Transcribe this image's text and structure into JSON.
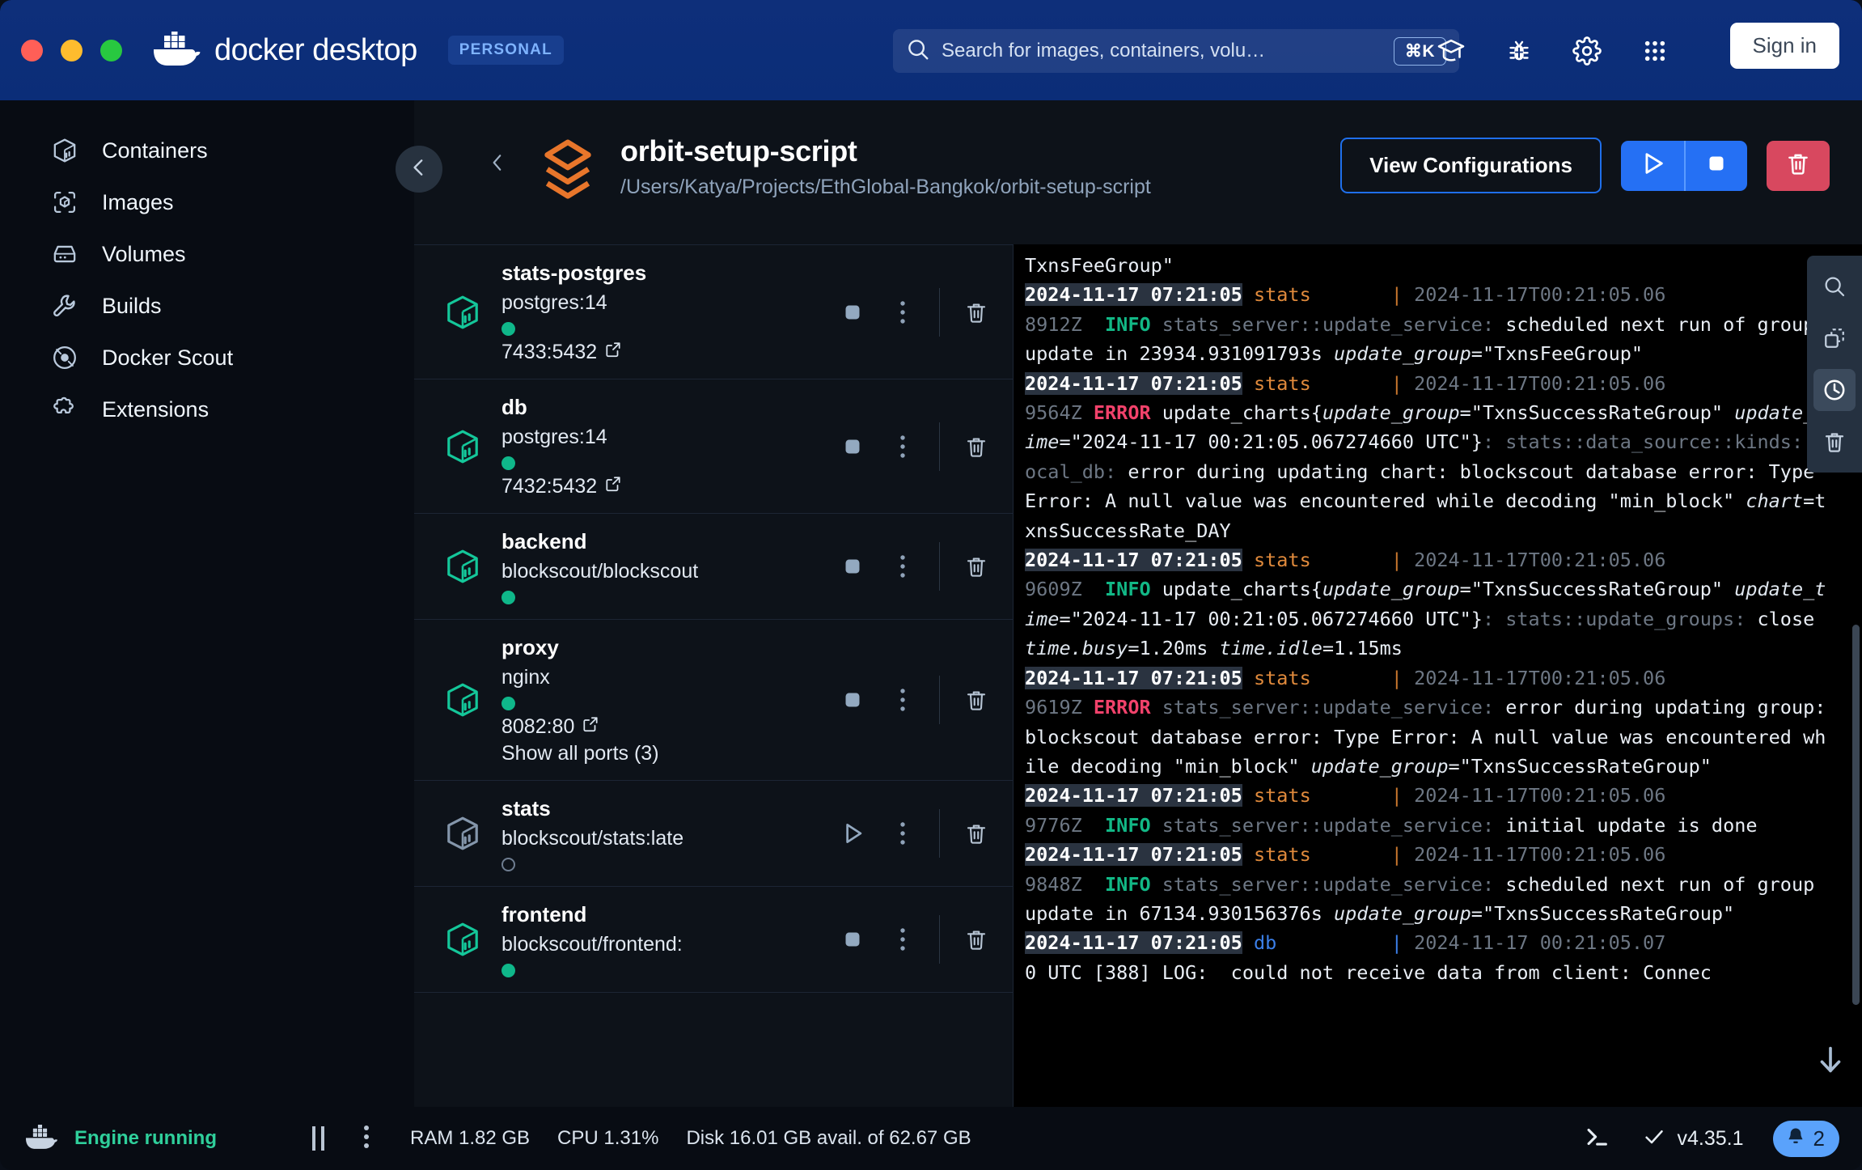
{
  "titlebar": {
    "brand": "docker desktop",
    "badge": "PERSONAL",
    "search_placeholder": "Search for images, containers, volu…",
    "search_value": "",
    "shortcut": "⌘K",
    "icons": [
      "learning-center-icon",
      "bug-icon",
      "gear-icon",
      "apps-grid-icon"
    ],
    "signin_label": "Sign in"
  },
  "sidebar": {
    "items": [
      {
        "label": "Containers",
        "icon": "container-cube-icon"
      },
      {
        "label": "Images",
        "icon": "images-icon"
      },
      {
        "label": "Volumes",
        "icon": "volumes-icon"
      },
      {
        "label": "Builds",
        "icon": "wrench-icon"
      },
      {
        "label": "Docker Scout",
        "icon": "scout-icon"
      },
      {
        "label": "Extensions",
        "icon": "puzzle-icon"
      }
    ]
  },
  "page": {
    "title": "orbit-setup-script",
    "path": "/Users/Katya/Projects/EthGlobal-Bangkok/orbit-setup-script",
    "view_configurations_label": "View Configurations",
    "actions": [
      "start-button",
      "stop-button",
      "delete-button"
    ]
  },
  "containers": [
    {
      "name": "stats-postgres",
      "image": "postgres:14",
      "state": "running",
      "port": "7433:5432",
      "more_ports": "",
      "action": "stop"
    },
    {
      "name": "db",
      "image": "postgres:14",
      "state": "running",
      "port": "7432:5432",
      "more_ports": "",
      "action": "stop"
    },
    {
      "name": "backend",
      "image": "blockscout/blockscout",
      "state": "running",
      "port": "",
      "more_ports": "",
      "action": "stop"
    },
    {
      "name": "proxy",
      "image": "nginx",
      "state": "running",
      "port": "8082:80",
      "more_ports": "Show all ports (3)",
      "action": "stop"
    },
    {
      "name": "stats",
      "image": "blockscout/stats:late",
      "state": "exited",
      "port": "",
      "more_ports": "",
      "action": "start"
    },
    {
      "name": "frontend",
      "image": "blockscout/frontend:",
      "state": "running",
      "port": "",
      "more_ports": "",
      "action": "stop"
    }
  ],
  "logs": {
    "tools": [
      "search-icon",
      "copy-icon",
      "clock-icon",
      "trash-icon"
    ],
    "active_tool": "clock-icon",
    "lines": [
      {
        "type": "cont",
        "segments": [
          {
            "t": "TxnsFeeGroup\"",
            "c": "wh"
          }
        ]
      },
      {
        "type": "head",
        "ts": "2024-11-17 07:21:05",
        "svc": "stats",
        "svc_color": "svc-stats",
        "tail": "2024-11-17T00:21:05.06"
      },
      {
        "type": "cont",
        "segments": [
          {
            "t": "8912Z ",
            "c": "dim"
          },
          {
            "t": " INFO",
            "c": "lv-info"
          },
          {
            "t": " stats_server::update_service: ",
            "c": "dim"
          },
          {
            "t": "scheduled next run of group update in 23934.931091793s ",
            "c": "wh"
          },
          {
            "t": "update_group",
            "c": "em"
          },
          {
            "t": "=\"TxnsFeeGroup\"",
            "c": "wh"
          }
        ]
      },
      {
        "type": "head",
        "ts": "2024-11-17 07:21:05",
        "svc": "stats",
        "svc_color": "svc-stats",
        "tail": "2024-11-17T00:21:05.06"
      },
      {
        "type": "cont",
        "segments": [
          {
            "t": "9564Z ",
            "c": "dim"
          },
          {
            "t": "ERROR",
            "c": "lv-error"
          },
          {
            "t": " update_charts{",
            "c": "wh"
          },
          {
            "t": "update_group",
            "c": "em"
          },
          {
            "t": "=\"TxnsSuccessRateGroup\" ",
            "c": "wh"
          },
          {
            "t": "update_time",
            "c": "em"
          },
          {
            "t": "=\"2024-11-17 00:21:05.067274660 UTC\"}",
            "c": "wh"
          },
          {
            "t": ": stats::data_source::kinds::local_db: ",
            "c": "dim"
          },
          {
            "t": "error during updating chart: blockscout database error: Type Error: A null value was encountered while decoding \"min_block\" ",
            "c": "wh"
          },
          {
            "t": "chart",
            "c": "em"
          },
          {
            "t": "=txnsSuccessRate_DAY",
            "c": "wh"
          }
        ]
      },
      {
        "type": "head",
        "ts": "2024-11-17 07:21:05",
        "svc": "stats",
        "svc_color": "svc-stats",
        "tail": "2024-11-17T00:21:05.06"
      },
      {
        "type": "cont",
        "segments": [
          {
            "t": "9609Z ",
            "c": "dim"
          },
          {
            "t": " INFO",
            "c": "lv-info"
          },
          {
            "t": " update_charts{",
            "c": "wh"
          },
          {
            "t": "update_group",
            "c": "em"
          },
          {
            "t": "=\"TxnsSuccessRateGroup\" ",
            "c": "wh"
          },
          {
            "t": "update_time",
            "c": "em"
          },
          {
            "t": "=\"2024-11-17 00:21:05.067274660 UTC\"}",
            "c": "wh"
          },
          {
            "t": ": stats::update_groups: ",
            "c": "dim"
          },
          {
            "t": "close ",
            "c": "wh"
          },
          {
            "t": "time.busy",
            "c": "em"
          },
          {
            "t": "=1.20ms ",
            "c": "wh"
          },
          {
            "t": "time.idle",
            "c": "em"
          },
          {
            "t": "=1.15ms",
            "c": "wh"
          }
        ]
      },
      {
        "type": "head",
        "ts": "2024-11-17 07:21:05",
        "svc": "stats",
        "svc_color": "svc-stats",
        "tail": "2024-11-17T00:21:05.06"
      },
      {
        "type": "cont",
        "segments": [
          {
            "t": "9619Z ",
            "c": "dim"
          },
          {
            "t": "ERROR",
            "c": "lv-error"
          },
          {
            "t": " stats_server::update_service: ",
            "c": "dim"
          },
          {
            "t": "error during updating group: blockscout database error: Type Error: A null value was encountered while decoding \"min_block\" ",
            "c": "wh"
          },
          {
            "t": "update_group",
            "c": "em"
          },
          {
            "t": "=\"TxnsSuccessRateGroup\"",
            "c": "wh"
          }
        ]
      },
      {
        "type": "head",
        "ts": "2024-11-17 07:21:05",
        "svc": "stats",
        "svc_color": "svc-stats",
        "tail": "2024-11-17T00:21:05.06"
      },
      {
        "type": "cont",
        "segments": [
          {
            "t": "9776Z ",
            "c": "dim"
          },
          {
            "t": " INFO",
            "c": "lv-info"
          },
          {
            "t": " stats_server::update_service: ",
            "c": "dim"
          },
          {
            "t": "initial update is done",
            "c": "wh"
          }
        ]
      },
      {
        "type": "head",
        "ts": "2024-11-17 07:21:05",
        "svc": "stats",
        "svc_color": "svc-stats",
        "tail": "2024-11-17T00:21:05.06"
      },
      {
        "type": "cont",
        "segments": [
          {
            "t": "9848Z ",
            "c": "dim"
          },
          {
            "t": " INFO",
            "c": "lv-info"
          },
          {
            "t": " stats_server::update_service: ",
            "c": "dim"
          },
          {
            "t": "scheduled next run of group update in 67134.930156376s ",
            "c": "wh"
          },
          {
            "t": "update_group",
            "c": "em"
          },
          {
            "t": "=\"TxnsSuccessRateGroup\"",
            "c": "wh"
          }
        ]
      },
      {
        "type": "head",
        "ts": "2024-11-17 07:21:05",
        "svc": "db",
        "svc_color": "svc-db",
        "tail": "2024-11-17 00:21:05.07"
      },
      {
        "type": "cont",
        "segments": [
          {
            "t": "0 UTC [388] LOG:  could not receive data from client: Connec",
            "c": "wh"
          }
        ]
      }
    ]
  },
  "statusbar": {
    "engine": "Engine running",
    "ram": "RAM 1.82 GB",
    "cpu": "CPU 1.31%",
    "disk": "Disk 16.01 GB avail. of 62.67 GB",
    "version": "v4.35.1",
    "notifications": "2"
  }
}
